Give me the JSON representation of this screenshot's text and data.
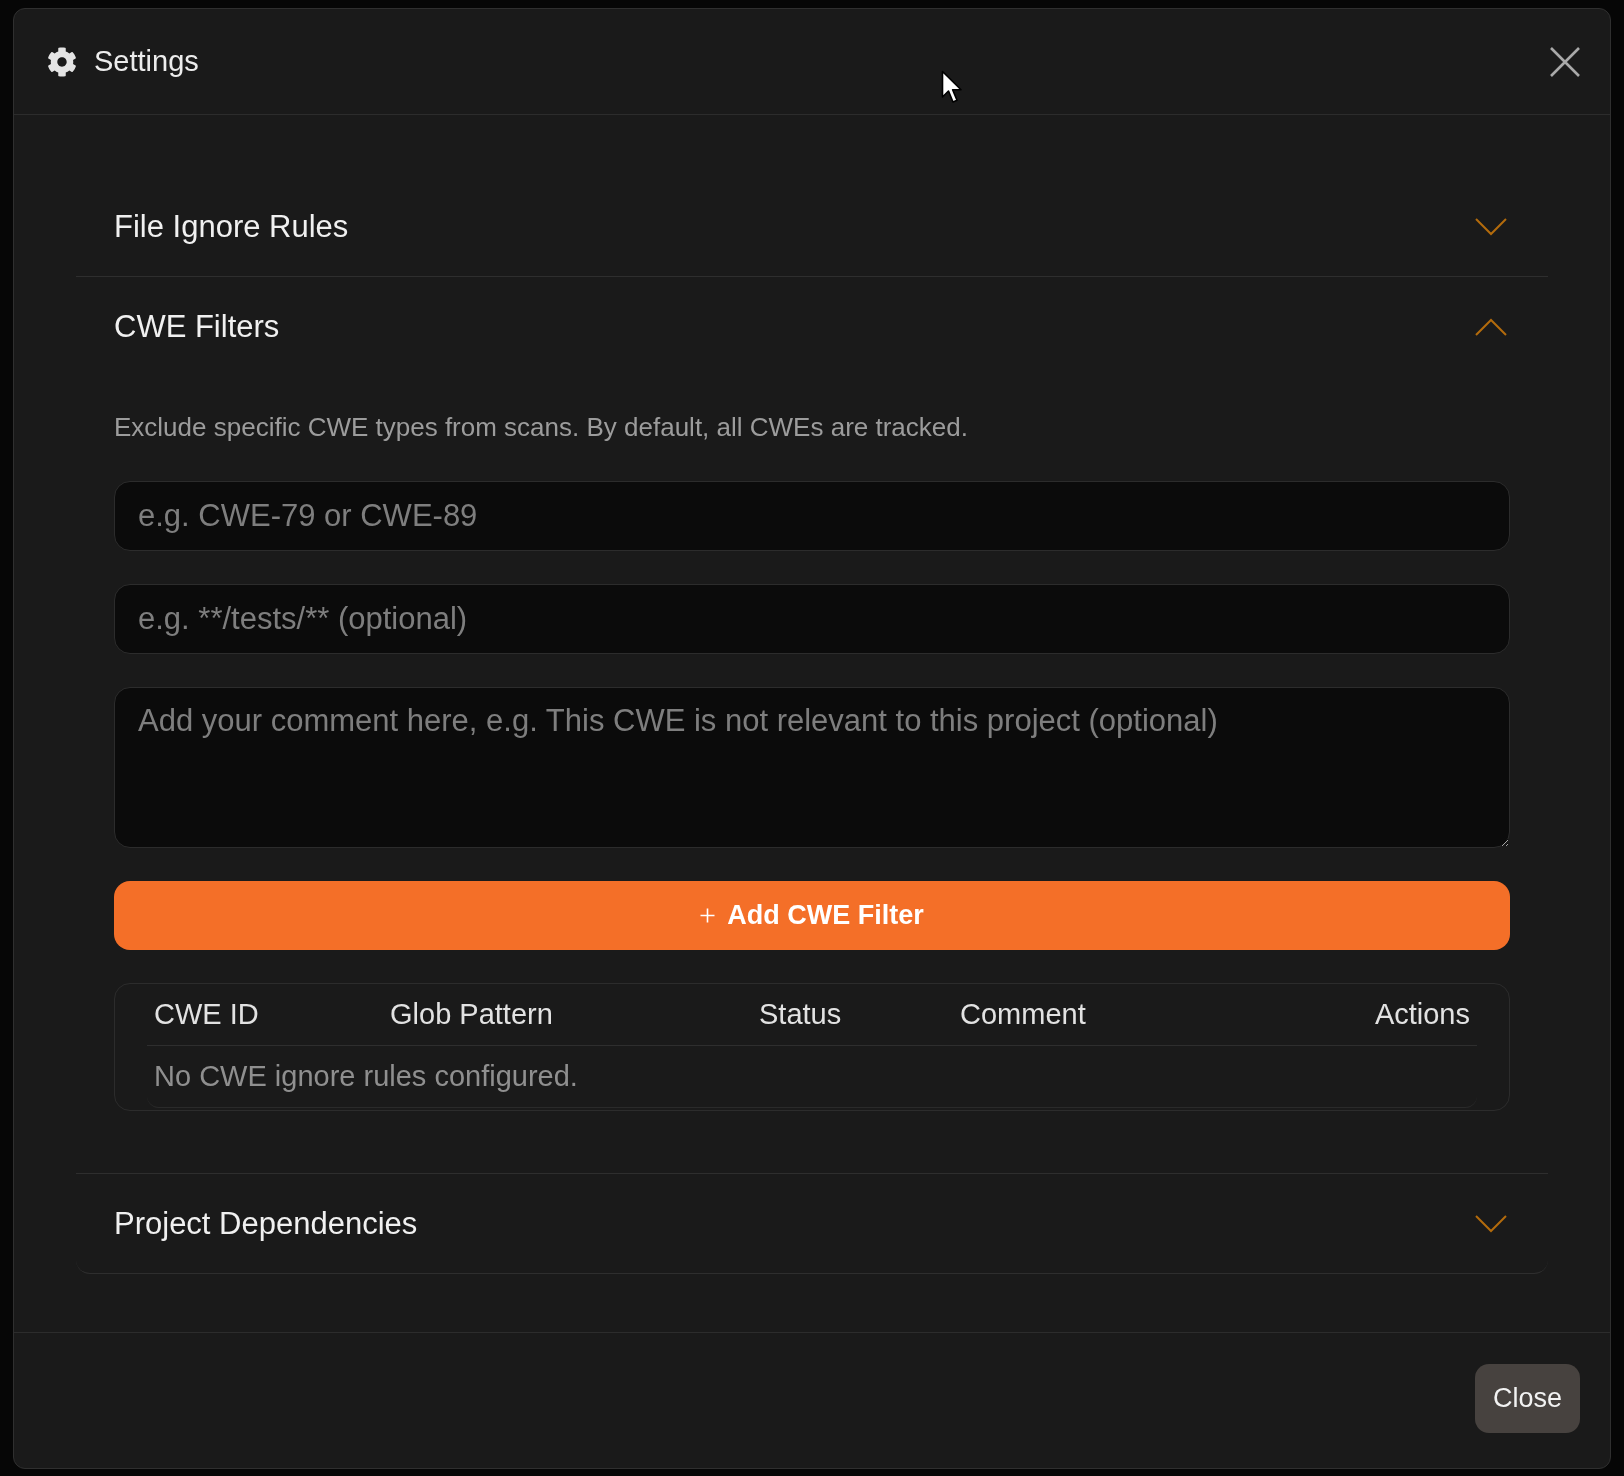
{
  "dialog": {
    "title": "Settings"
  },
  "sections": [
    {
      "title": "File Ignore Rules",
      "expanded": false
    },
    {
      "title": "CWE Filters",
      "expanded": true,
      "description": "Exclude specific CWE types from scans. By default, all CWEs are tracked.",
      "fields": [
        {
          "kind": "input",
          "placeholder": "e.g. CWE-79 or CWE-89"
        },
        {
          "kind": "input",
          "placeholder": "e.g. **/tests/** (optional)"
        },
        {
          "kind": "textarea",
          "placeholder": "Add your comment here, e.g. This CWE is not relevant to this project (optional)"
        }
      ],
      "add_button": {
        "label": "Add CWE Filter"
      },
      "table": {
        "columns": [
          "CWE ID",
          "Glob Pattern",
          "Status",
          "Comment",
          "Actions"
        ],
        "empty_message": "No CWE ignore rules configured."
      }
    },
    {
      "title": "Project Dependencies",
      "expanded": false
    }
  ],
  "footer": {
    "buttons": [
      "Close"
    ]
  }
}
